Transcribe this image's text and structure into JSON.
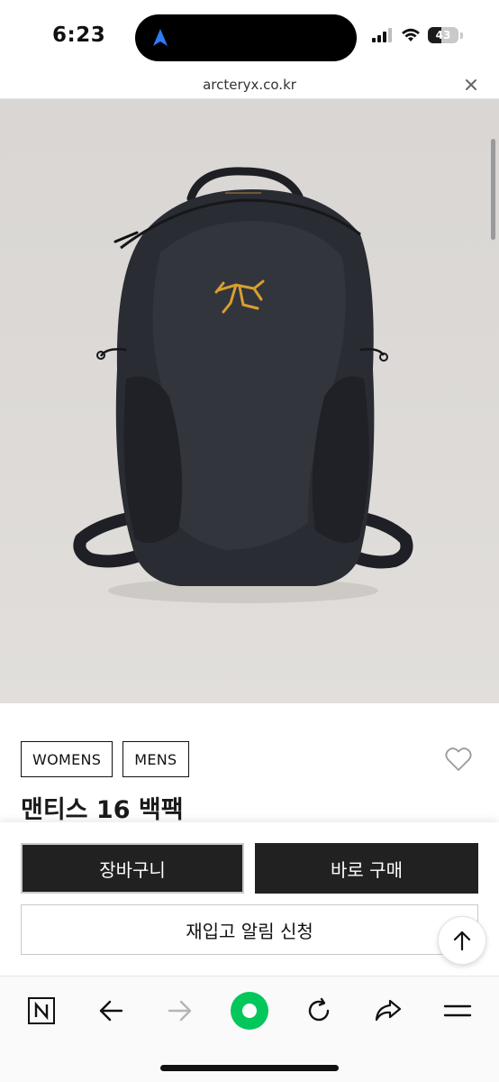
{
  "status_bar": {
    "time": "6:23",
    "battery_level": "43",
    "battery_fraction": 0.43,
    "navigation_active_color": "#2f7bf6"
  },
  "url_bar": {
    "domain": "arcteryx.co.kr",
    "close_icon": "close-icon"
  },
  "product": {
    "image_subject": "backpack-photo",
    "logo_color": "#d9a02e",
    "tags": [
      "WOMENS",
      "MENS"
    ],
    "title": "맨티스 16 백팩",
    "wishlist_icon": "heart-icon"
  },
  "actions": {
    "cart_label": "장바구니",
    "buy_label": "바로 구매",
    "restock_label": "재입고 알림 신청",
    "scroll_top_icon": "arrow-up-icon"
  },
  "toolbar": {
    "items": [
      "naver-icon",
      "back-icon",
      "forward-icon",
      "green-dot-icon",
      "reload-icon",
      "share-icon",
      "menu-icon"
    ],
    "accent_color": "#03c75a"
  }
}
